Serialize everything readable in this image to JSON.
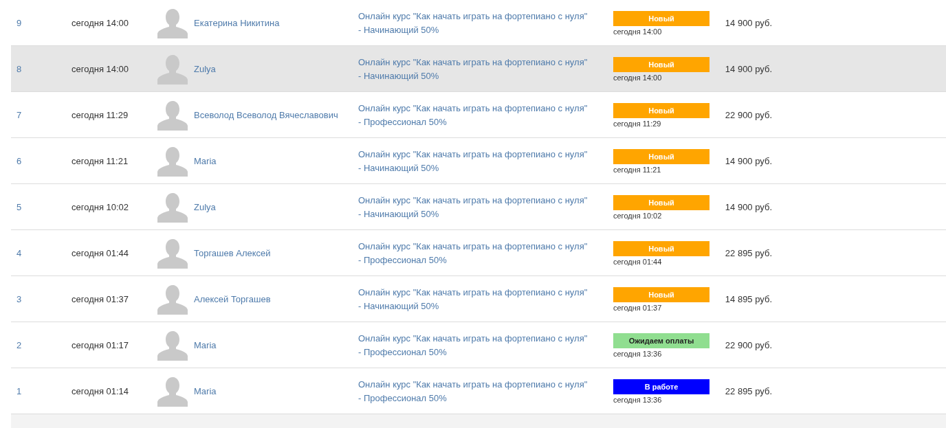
{
  "orders": [
    {
      "number": "9",
      "date": "сегодня 14:00",
      "customer": "Екатерина Никитина",
      "course_title": "Онлайн курс \"Как начать играть на фортепиано с нуля\"",
      "course_level": "- Начинающий 50%",
      "status": {
        "label": "Новый",
        "color": "#ffa500",
        "date": "сегодня 14:00"
      },
      "price": "14 900 руб.",
      "selected": false
    },
    {
      "number": "8",
      "date": "сегодня 14:00",
      "customer": "Zulya",
      "course_title": "Онлайн курс \"Как начать играть на фортепиано с нуля\"",
      "course_level": "- Начинающий 50%",
      "status": {
        "label": "Новый",
        "color": "#ffa500",
        "date": "сегодня 14:00"
      },
      "price": "14 900 руб.",
      "selected": true
    },
    {
      "number": "7",
      "date": "сегодня 11:29",
      "customer": "Всеволод Всеволод Вячеславович",
      "course_title": "Онлайн курс \"Как начать играть на фортепиано с нуля\"",
      "course_level": "- Профессионал 50%",
      "status": {
        "label": "Новый",
        "color": "#ffa500",
        "date": "сегодня 11:29"
      },
      "price": "22 900 руб.",
      "selected": false
    },
    {
      "number": "6",
      "date": "сегодня 11:21",
      "customer": "Maria",
      "course_title": "Онлайн курс \"Как начать играть на фортепиано с нуля\"",
      "course_level": "- Начинающий 50%",
      "status": {
        "label": "Новый",
        "color": "#ffa500",
        "date": "сегодня 11:21"
      },
      "price": "14 900 руб.",
      "selected": false
    },
    {
      "number": "5",
      "date": "сегодня 10:02",
      "customer": "Zulya",
      "course_title": "Онлайн курс \"Как начать играть на фортепиано с нуля\"",
      "course_level": "- Начинающий 50%",
      "status": {
        "label": "Новый",
        "color": "#ffa500",
        "date": "сегодня 10:02"
      },
      "price": "14 900 руб.",
      "selected": false
    },
    {
      "number": "4",
      "date": "сегодня 01:44",
      "customer": "Торгашев Алексей",
      "course_title": "Онлайн курс \"Как начать играть на фортепиано с нуля\"",
      "course_level": "- Профессионал 50%",
      "status": {
        "label": "Новый",
        "color": "#ffa500",
        "date": "сегодня 01:44"
      },
      "price": "22 895 руб.",
      "selected": false
    },
    {
      "number": "3",
      "date": "сегодня 01:37",
      "customer": "Алексей Торгашев",
      "course_title": "Онлайн курс \"Как начать играть на фортепиано с нуля\"",
      "course_level": "- Начинающий 50%",
      "status": {
        "label": "Новый",
        "color": "#ffa500",
        "date": "сегодня 01:37"
      },
      "price": "14 895 руб.",
      "selected": false
    },
    {
      "number": "2",
      "date": "сегодня 01:17",
      "customer": "Maria",
      "course_title": "Онлайн курс \"Как начать играть на фортепиано с нуля\"",
      "course_level": "- Профессионал 50%",
      "status": {
        "label": "Ожидаем оплаты",
        "color": "#90de90",
        "date": "сегодня 13:36"
      },
      "price": "22 900 руб.",
      "selected": false
    },
    {
      "number": "1",
      "date": "сегодня 01:14",
      "customer": "Maria",
      "course_title": "Онлайн курс \"Как начать играть на фортепиано с нуля\"",
      "course_level": "- Профессионал 50%",
      "status": {
        "label": "В работе",
        "color": "#0000ff",
        "date": "сегодня 13:36"
      },
      "price": "22 895 руб.",
      "selected": false
    }
  ]
}
